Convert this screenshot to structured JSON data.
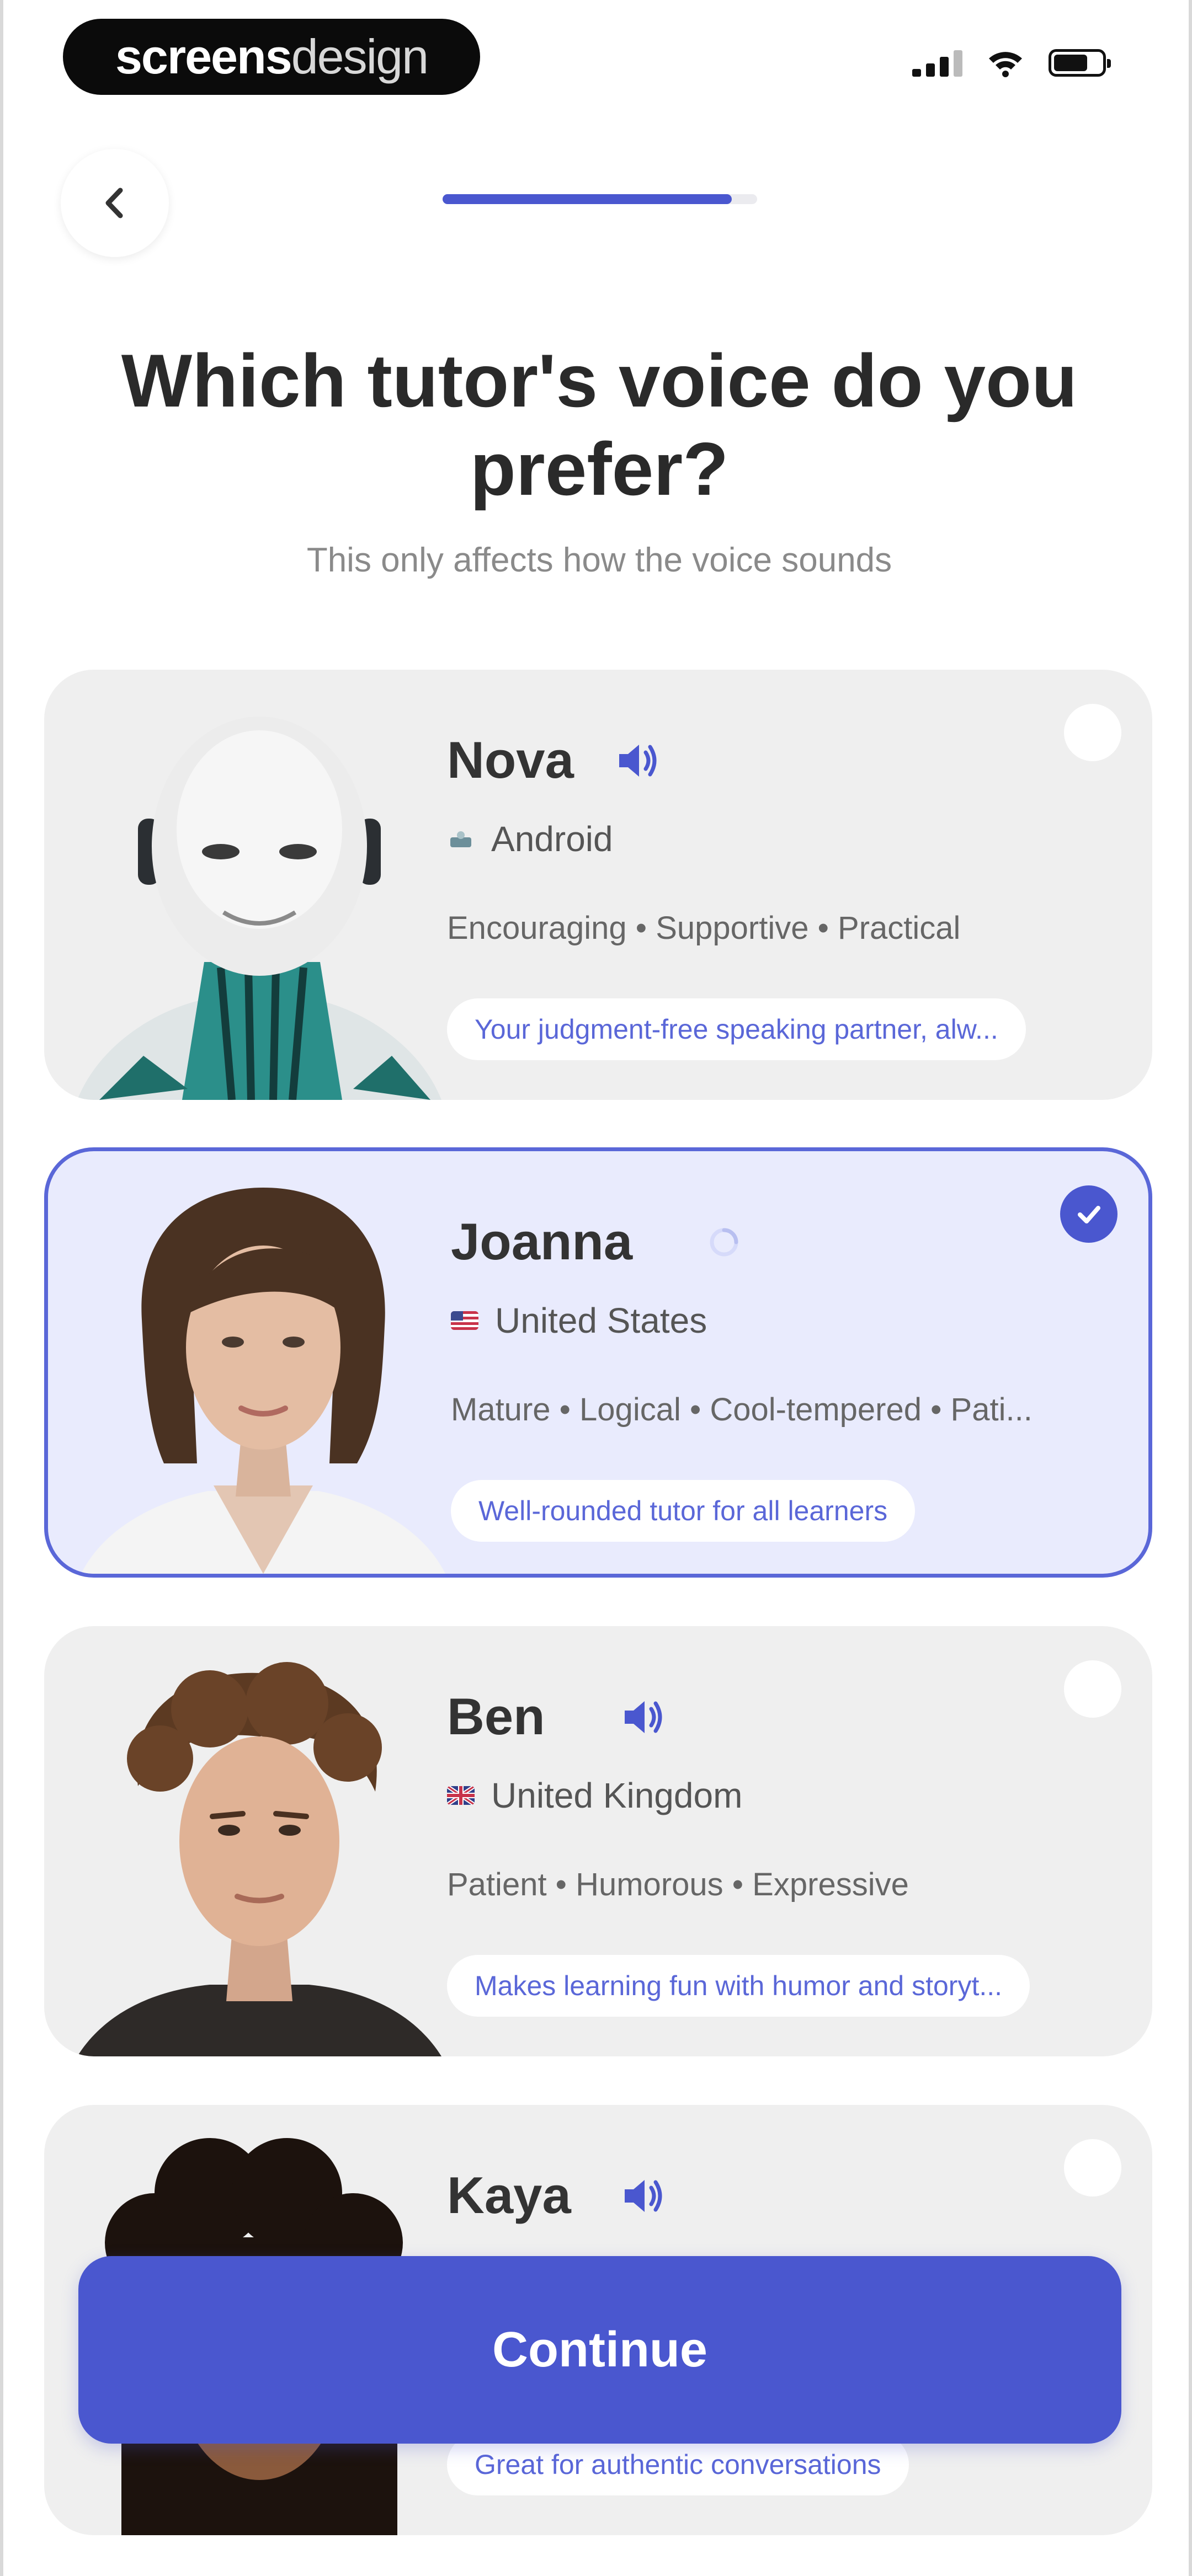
{
  "brand": {
    "bold": "screens",
    "light": "design"
  },
  "header": {
    "progress": 0.92
  },
  "title": "Which tutor's voice do you prefer?",
  "subtitle": "This only affects how the voice sounds",
  "tutors": [
    {
      "name": "Nova",
      "origin": "Android",
      "traits": "Encouraging • Supportive • Practical",
      "tagline": "Your judgment-free speaking partner, alw...",
      "selected": false,
      "speaker_icon": "speaker-icon"
    },
    {
      "name": "Joanna",
      "origin": "United States",
      "traits": "Mature • Logical • Cool-tempered • Pati...",
      "tagline": "Well-rounded tutor for all learners",
      "selected": true,
      "speaker_icon": "speaker-loading-icon"
    },
    {
      "name": "Ben",
      "origin": "United Kingdom",
      "traits": "Patient • Humorous • Expressive",
      "tagline": "Makes learning fun with humor and storyt...",
      "selected": false,
      "speaker_icon": "speaker-icon"
    },
    {
      "name": "Kaya",
      "origin": "",
      "traits": "",
      "tagline": "Great for authentic conversations",
      "selected": false,
      "speaker_icon": "speaker-icon"
    }
  ],
  "continue_label": "Continue",
  "colors": {
    "accent": "#4a57cf",
    "card": "#efefef",
    "selected_card": "#e9ebfd"
  }
}
